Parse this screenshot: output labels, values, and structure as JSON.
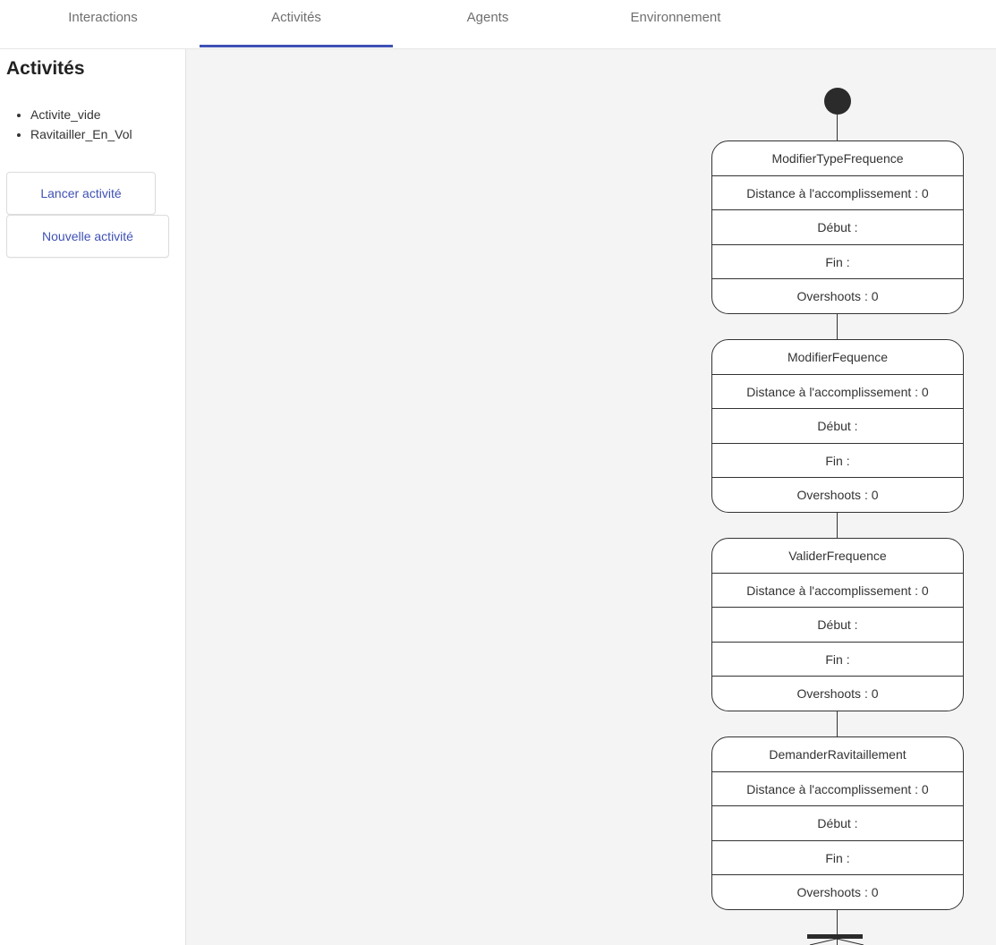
{
  "tabs": [
    {
      "label": "Interactions"
    },
    {
      "label": "Activités"
    },
    {
      "label": "Agents"
    },
    {
      "label": "Environnement"
    }
  ],
  "sidebar": {
    "title": "Activités",
    "items": [
      {
        "label": "Activite_vide"
      },
      {
        "label": "Ravitailler_En_Vol"
      }
    ],
    "launch_button": "Lancer activité",
    "new_button": "Nouvelle activité"
  },
  "diagram": {
    "states": [
      {
        "name": "ModifierTypeFrequence",
        "distance": "Distance à l'accomplissement : 0",
        "debut": "Début :",
        "fin": "Fin :",
        "overshoots": "Overshoots : 0"
      },
      {
        "name": "ModifierFequence",
        "distance": "Distance à l'accomplissement : 0",
        "debut": "Début :",
        "fin": "Fin :",
        "overshoots": "Overshoots : 0"
      },
      {
        "name": "ValiderFrequence",
        "distance": "Distance à l'accomplissement : 0",
        "debut": "Début :",
        "fin": "Fin :",
        "overshoots": "Overshoots : 0"
      },
      {
        "name": "DemanderRavitaillement",
        "distance": "Distance à l'accomplissement : 0",
        "debut": "Début :",
        "fin": "Fin :",
        "overshoots": "Overshoots : 0"
      }
    ]
  }
}
